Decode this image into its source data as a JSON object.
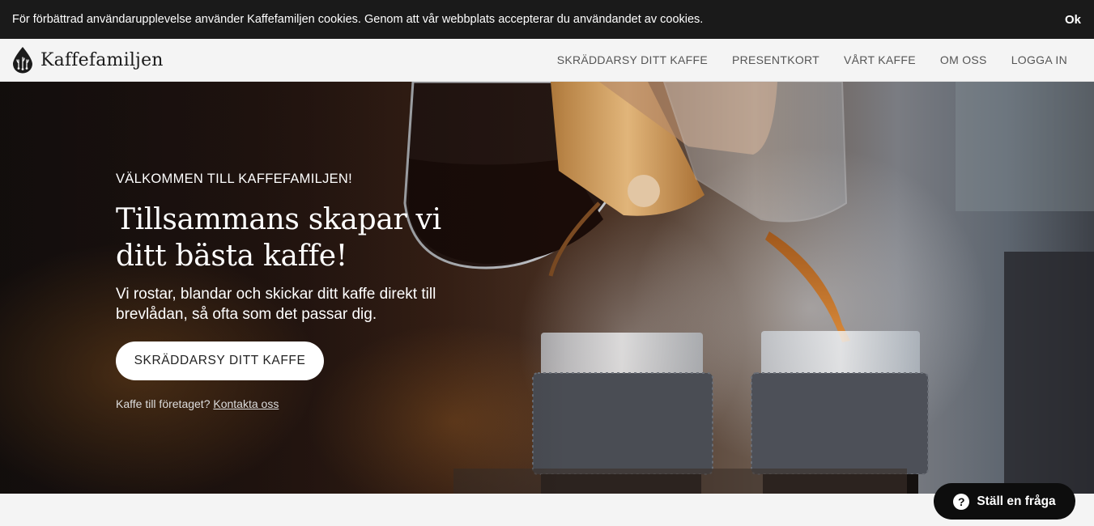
{
  "cookie_bar": {
    "message": "För förbättrad användarupplevelse använder Kaffefamiljen cookies. Genom att vår webbplats accepterar du användandet av cookies.",
    "ok_label": "Ok"
  },
  "header": {
    "brand": "Kaffefamiljen",
    "logo_icon": "coffee-drop-logo-icon",
    "nav": [
      {
        "label": "SKRÄDDARSY DITT KAFFE"
      },
      {
        "label": "PRESENTKORT"
      },
      {
        "label": "VÅRT KAFFE"
      },
      {
        "label": "OM OSS"
      },
      {
        "label": "LOGGA IN"
      }
    ]
  },
  "hero": {
    "eyebrow": "VÄLKOMMEN TILL KAFFEFAMILJEN!",
    "headline": "Tillsammans skapar vi ditt bästa kaffe!",
    "lead": "Vi rostar, blandar och skickar ditt kaffe direkt till brevlådan, så ofta som det passar dig.",
    "cta_label": "SKRÄDDARSY DITT KAFFE",
    "b2b_text": "Kaffe till företaget?",
    "b2b_link": "Kontakta oss"
  },
  "help": {
    "label": "Ställ en fråga",
    "icon": "question-circle-icon",
    "icon_glyph": "?"
  },
  "colors": {
    "cookie_bg": "#1a1a1a",
    "nav_bg": "#f4f4f4",
    "help_bg": "#0d0d0d"
  }
}
